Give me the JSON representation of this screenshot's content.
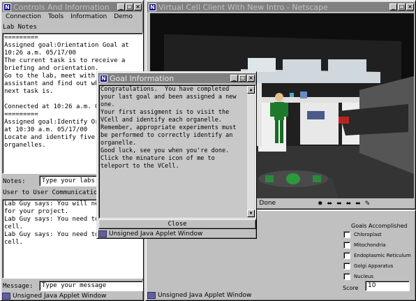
{
  "controls_window": {
    "title": "Controls And Information",
    "menu": [
      "Connection",
      "Tools",
      "Information",
      "Demo"
    ],
    "lab_notes_label": "Lab Notes",
    "lab_notes_text": "=========\nAssigned goal:Orientation Goal at\n10:26 a.m. 05/17/00\nThe current task is to receive a\nbriefing and orientation.\nGo to the lab, meet with \nassistant and find out wh\nnext task is.\n\nConnected at 10:26 a.m. 04\n=========\nAssigned goal:Identify Or\nat 10:30 a.m. 05/17/00\nLocate and identify five o\norganelles.",
    "notes_label": "Notes:",
    "notes_value": "Type your labs",
    "chat_label": "User to User Communication",
    "chat_text": "Lab Guy says: You will ne\nfor your project.\nLab Guy says: You need to\ncell.\nLab Guy says: You need to\ncell.",
    "message_label": "Message:",
    "message_value": "Type your message",
    "status": "Unsigned Java Applet Window"
  },
  "netscape_window": {
    "title": "Virtual Cell Client With New Intro - Netscape",
    "status_text": "t Done",
    "applet_status": "Unsigned Java Applet Window"
  },
  "goals_panel": {
    "heading": "Goals Accomplished",
    "items": [
      "Chloroplast",
      "Mitochondria",
      "Endoplasmic Reticulum",
      "Golgi Apparatus",
      "Nucleus"
    ],
    "score_label": "Score",
    "score_value": "10"
  },
  "goal_dialog": {
    "title": "Goal Information",
    "message": "Congratulations.  You have completed\nyour last goal and been assigned a new\none.\nYour first assigment is to visit the\nVCell and identify each organelle.\nRemember, appropriate experiments must\nbe performed to correctly identify an\norganelle.\nGood luck, see you when you're done.\nClick the minature icon of me to\nteleport to the VCell.",
    "close_label": "Close",
    "status": "Unsigned Java Applet Window"
  },
  "colors": {
    "title_inactive": "#808080",
    "desktop": "#c0c0c0",
    "scene_bg": "#0e0e0e",
    "lab_floor": "#343434"
  }
}
